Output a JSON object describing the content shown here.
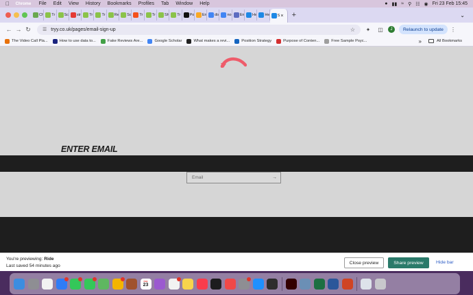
{
  "menubar": {
    "app": "Chrome",
    "items": [
      "File",
      "Edit",
      "View",
      "History",
      "Bookmarks",
      "Profiles",
      "Tab",
      "Window",
      "Help"
    ],
    "datetime": "Fri 23 Feb  15:45"
  },
  "tabs": [
    {
      "label": "Ch",
      "color": "#6aa84f"
    },
    {
      "label": "Tr",
      "color": "#8bc34a"
    },
    {
      "label": "Sc",
      "color": "#8bc34a"
    },
    {
      "label": "str",
      "color": "#e53935"
    },
    {
      "label": "Tr",
      "color": "#8bc34a"
    },
    {
      "label": "Tr",
      "color": "#8bc34a"
    },
    {
      "label": "Re",
      "color": "#8bc34a"
    },
    {
      "label": "Sc",
      "color": "#8bc34a"
    },
    {
      "label": "Tr",
      "color": "#f4511e"
    },
    {
      "label": "Tr",
      "color": "#8bc34a"
    },
    {
      "label": "Sh",
      "color": "#8bc34a"
    },
    {
      "label": "Tr",
      "color": "#8bc34a"
    },
    {
      "label": "Po",
      "color": "#111111"
    },
    {
      "label": "En",
      "color": "#f9a825"
    },
    {
      "label": "dis",
      "color": "#4285f4"
    },
    {
      "label": "no",
      "color": "#4285f4"
    },
    {
      "label": "En",
      "color": "#5c6bc0"
    },
    {
      "label": "He",
      "color": "#1e88e5"
    },
    {
      "label": "He",
      "color": "#1e88e5"
    },
    {
      "label": "S",
      "color": "#1e88e5"
    }
  ],
  "toolbar": {
    "url": "tryy.co.uk/pages/email-sign-up",
    "profile_initial": "J",
    "relaunch_label": "Relaunch to update"
  },
  "bookmarks": [
    {
      "label": "The Video Call Pla...",
      "color": "#e8710a"
    },
    {
      "label": "How to use data to...",
      "color": "#1a237e"
    },
    {
      "label": "Fake Reviews Are...",
      "color": "#43a047"
    },
    {
      "label": "Google Scholar",
      "color": "#4285f4"
    },
    {
      "label": "What makes a revi...",
      "color": "#212121"
    },
    {
      "label": "Position Strategy",
      "color": "#1565c0"
    },
    {
      "label": "Purpose of Conten...",
      "color": "#d32f2f"
    },
    {
      "label": "Free Sample Psyc...",
      "color": "#9e9e9e"
    }
  ],
  "bookmarks_all": "All Bookmarks",
  "page": {
    "heading": "ENTER EMAIL",
    "email_placeholder": "Email",
    "logo_color": "#ee5c6a"
  },
  "preview": {
    "line1_prefix": "You're previewing: ",
    "theme": "Ride",
    "line2": "Last saved 54 minutes ago",
    "close_label": "Close preview",
    "share_label": "Share preview",
    "hide_label": "Hide bar"
  },
  "dock": {
    "calendar_month": "FEB",
    "calendar_day": "23",
    "apps": [
      {
        "name": "finder",
        "color": "#3b8de0"
      },
      {
        "name": "launchpad",
        "color": "#8e8e93"
      },
      {
        "name": "chrome",
        "color": "#f2f2f2"
      },
      {
        "name": "mail",
        "color": "#2f7cf6"
      },
      {
        "name": "facetime",
        "color": "#34c759"
      },
      {
        "name": "messages",
        "color": "#34c759"
      },
      {
        "name": "maps",
        "color": "#5fb760"
      },
      {
        "name": "photos",
        "color": "#f4b400"
      },
      {
        "name": "dictionary",
        "color": "#a0522d"
      },
      {
        "name": "calendar",
        "color": "#ffffff"
      },
      {
        "name": "podcasts",
        "color": "#9b59d0"
      },
      {
        "name": "reminders",
        "color": "#f2f2f2"
      },
      {
        "name": "notes",
        "color": "#f7d44c"
      },
      {
        "name": "music",
        "color": "#fa3c4c"
      },
      {
        "name": "tv",
        "color": "#1c1c1e"
      },
      {
        "name": "news",
        "color": "#f04848"
      },
      {
        "name": "system-settings",
        "color": "#8e8e93"
      },
      {
        "name": "app-store",
        "color": "#1e90ff"
      },
      {
        "name": "finalcut",
        "color": "#2d2d2d"
      },
      {
        "name": "illustrator",
        "color": "#330000"
      },
      {
        "name": "preview",
        "color": "#6b8fb5"
      },
      {
        "name": "excel",
        "color": "#1d6f42"
      },
      {
        "name": "word",
        "color": "#2b579a"
      },
      {
        "name": "powerpoint",
        "color": "#d04423"
      },
      {
        "name": "downloads",
        "color": "#dde3ea"
      },
      {
        "name": "trash",
        "color": "#c8c8cc"
      }
    ]
  }
}
